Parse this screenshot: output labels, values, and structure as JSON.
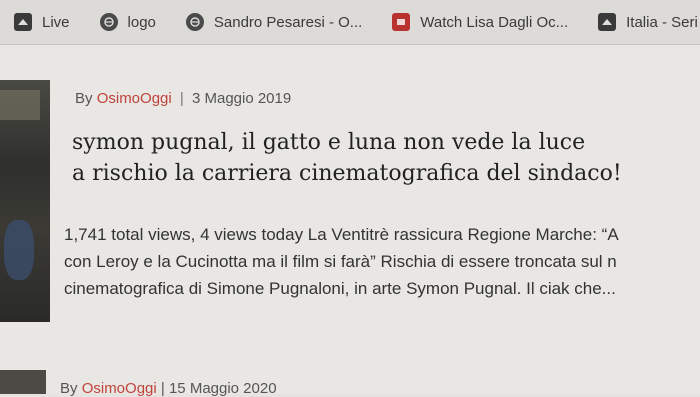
{
  "bookmarks": [
    {
      "label": "Live",
      "icon": "film-icon"
    },
    {
      "label": "logo",
      "icon": "globe-icon"
    },
    {
      "label": "Sandro Pesaresi - O...",
      "icon": "globe-icon"
    },
    {
      "label": "Watch Lisa Dagli Oc...",
      "icon": "video-icon"
    },
    {
      "label": "Italia - Seri",
      "icon": "film-icon"
    }
  ],
  "article": {
    "by": "By",
    "author": "OsimoOggi",
    "sep": "|",
    "date": "3 Maggio 2019",
    "title_line1": "symon pugnal, il gatto e luna non vede la luce",
    "title_line2": "a rischio la carriera cinematografica del sindaco!",
    "excerpt_line1": "1,741 total views,  4 views today La Ventitrè rassicura Regione Marche: “A",
    "excerpt_line2": "con Leroy e la Cucinotta ma il film si farà” Rischia di essere troncata sul n",
    "excerpt_line3": "cinematografica di Simone Pugnaloni, in arte Symon Pugnal. Il ciak che..."
  },
  "next_article": {
    "by": "By",
    "author": "OsimoOggi",
    "sep": "|",
    "date": "15 Maggio 2020"
  }
}
